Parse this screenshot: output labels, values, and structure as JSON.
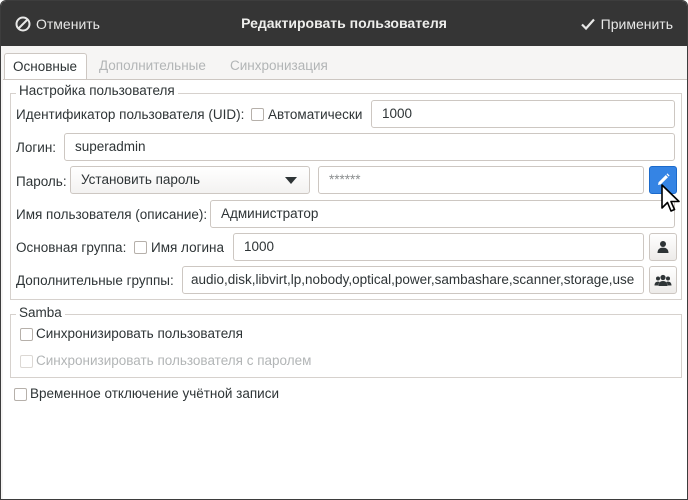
{
  "header": {
    "cancel_label": "Отменить",
    "title": "Редактировать пользователя",
    "apply_label": "Применить"
  },
  "tabs": [
    {
      "label": "Основные",
      "active": true
    },
    {
      "label": "Дополнительные",
      "active": false
    },
    {
      "label": "Синхронизация",
      "active": false
    }
  ],
  "user_settings": {
    "legend": "Настройка пользователя",
    "uid_label": "Идентификатор пользователя (UID):",
    "uid_auto_label": "Автоматически",
    "uid_auto_checked": false,
    "uid_value": "1000",
    "login_label": "Логин:",
    "login_value": "superadmin",
    "password_label": "Пароль:",
    "password_mode": "Установить пароль",
    "password_value": "******",
    "description_label": "Имя пользователя (описание):",
    "description_value": "Администратор",
    "primary_group_label": "Основная группа:",
    "primary_group_same_login_label": "Имя логина",
    "primary_group_same_login_checked": false,
    "primary_group_value": "1000",
    "extra_groups_label": "Дополнительные группы:",
    "extra_groups_value": "audio,disk,libvirt,lp,nobody,optical,power,sambashare,scanner,storage,use"
  },
  "samba": {
    "legend": "Samba",
    "sync_user_label": "Синхронизировать пользователя",
    "sync_user_checked": false,
    "sync_password_label": "Синхронизировать пользователя с паролем",
    "sync_password_enabled": false
  },
  "disable_account_label": "Временное отключение учётной записи",
  "disable_account_checked": false,
  "colors": {
    "headerbar": "#353535",
    "accent": "#3584e4"
  },
  "icons": [
    "cancel-icon",
    "check-icon",
    "edit-pencil-icon",
    "user-icon",
    "users-group-icon",
    "mouse-cursor-icon"
  ]
}
